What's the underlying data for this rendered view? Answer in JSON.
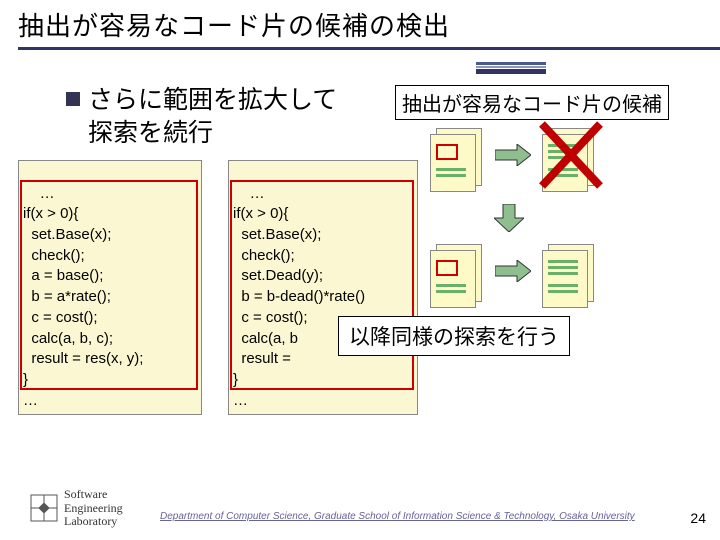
{
  "title": "抽出が容易なコード片の候補の検出",
  "bullet": "さらに範囲を拡大して\n探索を続行",
  "candidate_label": "抽出が容易なコード片の候補",
  "code_left": "…\nif(x > 0){\n  set.Base(x);\n  check();\n  a = base();\n  b = a*rate();\n  c = cost();\n  calc(a, b, c);\n  result = res(x, y);\n}\n…",
  "code_right": "…\nif(x > 0){\n  set.Base(x);\n  check();\n  set.Dead(y);\n  b = b-dead()*rate()\n  c = cost();\n  calc(a, b\n  result = \n}\n…",
  "continue_label": "以降同様の探索を行う",
  "footer": {
    "logo_line1": "Software",
    "logo_line2": "Engineering",
    "logo_line3": "Laboratory",
    "dept": "Department of Computer Science, Graduate School of Information Science & Technology, Osaka University",
    "page": "24"
  }
}
